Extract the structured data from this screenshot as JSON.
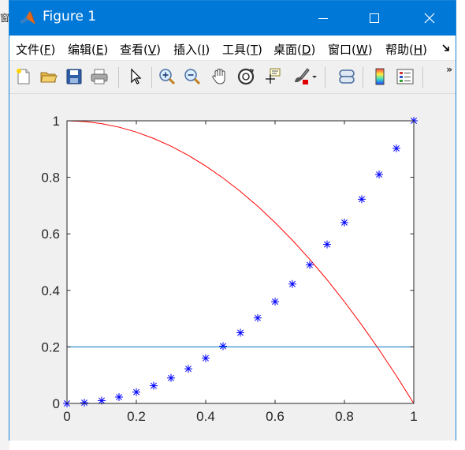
{
  "background_window": {
    "clipped_char": "窗"
  },
  "window": {
    "title": "Figure 1",
    "icon": "matlab-icon"
  },
  "menu": [
    {
      "label": "文件",
      "key": "F"
    },
    {
      "label": "编辑",
      "key": "E"
    },
    {
      "label": "查看",
      "key": "V"
    },
    {
      "label": "插入",
      "key": "I"
    },
    {
      "label": "工具",
      "key": "T"
    },
    {
      "label": "桌面",
      "key": "D"
    },
    {
      "label": "窗口",
      "key": "W"
    },
    {
      "label": "帮助",
      "key": "H"
    }
  ],
  "toolbar": {
    "buttons": [
      "new-figure-icon",
      "open-file-icon",
      "save-icon",
      "print-icon",
      "pointer-icon",
      "zoom-in-icon",
      "zoom-out-icon",
      "pan-hand-icon",
      "rotate-3d-icon",
      "data-cursor-icon",
      "brush-icon",
      "link-plot-icon",
      "colorbar-icon",
      "legend-icon"
    ],
    "overflow": "»"
  },
  "colors": {
    "titlebar": "#0078d7",
    "curve": "#ff0000",
    "markers": "#0000ff",
    "hline": "#0072bd"
  },
  "chart_data": {
    "type": "line",
    "title": "",
    "xlabel": "",
    "ylabel": "",
    "xlim": [
      0,
      1
    ],
    "ylim": [
      0,
      1
    ],
    "grid": false,
    "xticks": [
      "0",
      "0.2",
      "0.4",
      "0.6",
      "0.8",
      "1"
    ],
    "yticks": [
      "0",
      "0.2",
      "0.4",
      "0.6",
      "0.8",
      "1"
    ],
    "series": [
      {
        "style": "line",
        "color": "#ff0000",
        "x": [
          0,
          0.05,
          0.1,
          0.15,
          0.2,
          0.25,
          0.3,
          0.35,
          0.4,
          0.45,
          0.5,
          0.55,
          0.6,
          0.65,
          0.7,
          0.75,
          0.8,
          0.85,
          0.9,
          0.95,
          1
        ],
        "y": [
          1,
          0.9975,
          0.99,
          0.9775,
          0.96,
          0.9375,
          0.91,
          0.8775,
          0.84,
          0.7975,
          0.75,
          0.6975,
          0.64,
          0.5775,
          0.51,
          0.4375,
          0.36,
          0.2775,
          0.19,
          0.0975,
          0
        ]
      },
      {
        "style": "markers",
        "marker": "*",
        "color": "#0000ff",
        "x": [
          0,
          0.05,
          0.1,
          0.15,
          0.2,
          0.25,
          0.3,
          0.35,
          0.4,
          0.45,
          0.5,
          0.55,
          0.6,
          0.65,
          0.7,
          0.75,
          0.8,
          0.85,
          0.9,
          0.95,
          1
        ],
        "y": [
          0,
          0.0025,
          0.01,
          0.0225,
          0.04,
          0.0625,
          0.09,
          0.1225,
          0.16,
          0.2025,
          0.25,
          0.3025,
          0.36,
          0.4225,
          0.49,
          0.5625,
          0.64,
          0.7225,
          0.81,
          0.9025,
          1
        ]
      },
      {
        "style": "line",
        "color": "#0072bd",
        "x": [
          0,
          1
        ],
        "y": [
          0.2,
          0.2
        ]
      }
    ]
  }
}
